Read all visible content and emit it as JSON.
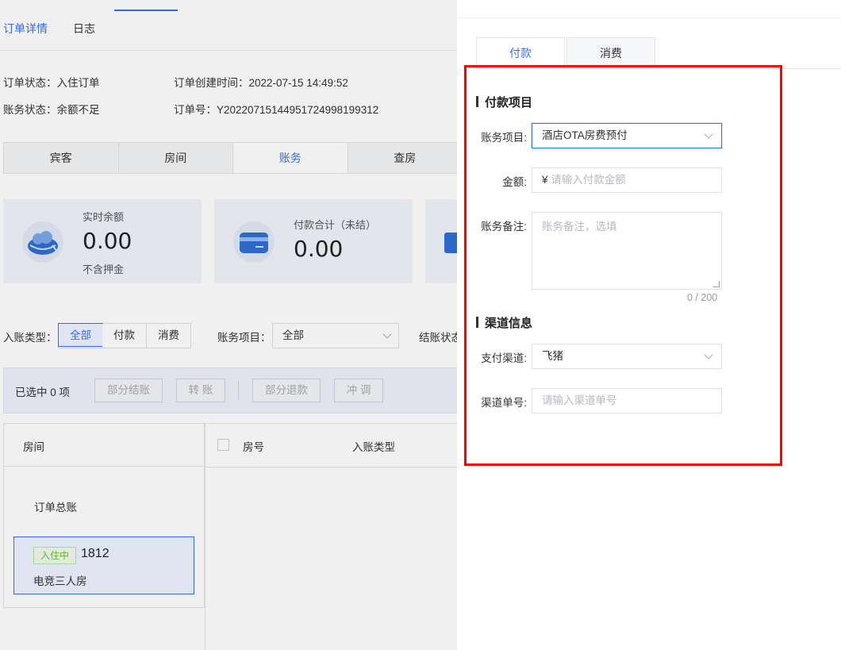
{
  "page": {
    "tabs": [
      {
        "label": "订单详情",
        "active": true
      },
      {
        "label": "日志",
        "active": false
      }
    ],
    "order_status_label": "订单状态：",
    "order_status": "入住订单",
    "account_status_label": "账务状态：",
    "account_status": "余额不足",
    "created_time_label": "订单创建时间：",
    "created_time": "2022-07-15 14:49:52",
    "order_no_label": "订单号：",
    "order_no": "Y20220715144951724998199312",
    "sub_tabs": [
      {
        "label": "宾客"
      },
      {
        "label": "房间"
      },
      {
        "label": "账务",
        "active": true
      },
      {
        "label": "查房"
      }
    ],
    "cards": [
      {
        "label": "实时余额",
        "value": "0.00",
        "sub": "不含押金"
      },
      {
        "label": "付款合计（未结）",
        "value": "0.00"
      }
    ],
    "filter": {
      "entry_type_label": "入账类型：",
      "segments": [
        "全部",
        "付款",
        "消费"
      ],
      "account_item_label": "账务项目：",
      "account_item_value": "全部",
      "settle_status_label": "结账状态"
    },
    "bulk": {
      "selected_text": "已选中 0 项",
      "buttons": [
        "部分结账",
        "转 账",
        "部分退款",
        "冲 调"
      ]
    },
    "rooms": {
      "header": "房间",
      "total": "订单总账",
      "room_badge": "入住中",
      "room_no": "1812",
      "room_type": "电竞三人房"
    },
    "table": {
      "columns": [
        "房号",
        "入账类型"
      ]
    }
  },
  "drawer": {
    "tabs": [
      {
        "label": "付款",
        "active": true
      },
      {
        "label": "消费",
        "active": false
      }
    ],
    "payment_section": "付款项目",
    "account_item_label": "账务项目",
    "account_item_value": "酒店OTA房费预付",
    "amount_label": "金额",
    "currency_symbol": "¥",
    "amount_placeholder": "请输入付款金额",
    "remark_label": "账务备注",
    "remark_placeholder": "账务备注，选填",
    "remark_counter": "0 / 200",
    "channel_section": "渠道信息",
    "pay_channel_label": "支付渠道",
    "pay_channel_value": "飞猪",
    "channel_no_label": "渠道单号",
    "channel_no_placeholder": "请输入渠道单号"
  },
  "colors": {
    "accent": "#3370ff",
    "highlight": "#ff0000",
    "badge_green": "#67c23a"
  }
}
